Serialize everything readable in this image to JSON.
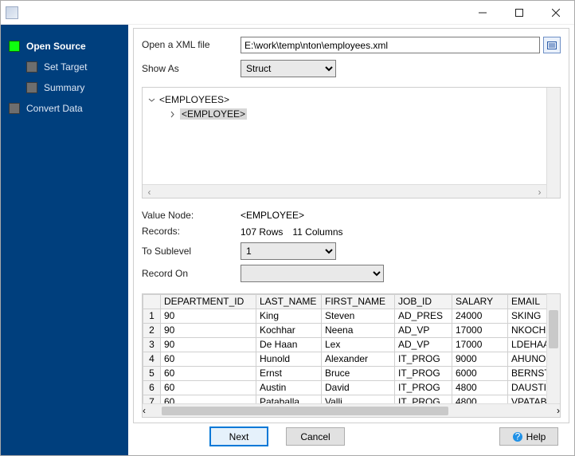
{
  "titlebar": {},
  "sidebar": {
    "items": [
      {
        "label": "Open Source",
        "active": true,
        "child": false
      },
      {
        "label": "Set Target",
        "active": false,
        "child": true
      },
      {
        "label": "Summary",
        "active": false,
        "child": true
      },
      {
        "label": "Convert Data",
        "active": false,
        "child": false
      }
    ]
  },
  "form": {
    "open_label": "Open a XML file",
    "file_path": "E:\\work\\temp\\nton\\employees.xml",
    "showas_label": "Show As",
    "showas_value": "Struct",
    "tree": {
      "root": "<EMPLOYEES>",
      "child": "<EMPLOYEE>"
    },
    "value_node_label": "Value Node:",
    "value_node": "<EMPLOYEE>",
    "records_label": "Records:",
    "records_rows": "107 Rows",
    "records_cols": "11 Columns",
    "tosub_label": "To Sublevel",
    "tosub_value": "1",
    "recordon_label": "Record On",
    "recordon_value": ""
  },
  "grid": {
    "columns": [
      "DEPARTMENT_ID",
      "LAST_NAME",
      "FIRST_NAME",
      "JOB_ID",
      "SALARY",
      "EMAIL"
    ],
    "rows": [
      {
        "n": "1",
        "dept": "90",
        "last": "King",
        "first": "Steven",
        "job": "AD_PRES",
        "sal": "24000",
        "email": "SKING"
      },
      {
        "n": "2",
        "dept": "90",
        "last": "Kochhar",
        "first": "Neena",
        "job": "AD_VP",
        "sal": "17000",
        "email": "NKOCHH"
      },
      {
        "n": "3",
        "dept": "90",
        "last": "De Haan",
        "first": "Lex",
        "job": "AD_VP",
        "sal": "17000",
        "email": "LDEHAAN"
      },
      {
        "n": "4",
        "dept": "60",
        "last": "Hunold",
        "first": "Alexander",
        "job": "IT_PROG",
        "sal": "9000",
        "email": "AHUNOL"
      },
      {
        "n": "5",
        "dept": "60",
        "last": "Ernst",
        "first": "Bruce",
        "job": "IT_PROG",
        "sal": "6000",
        "email": "BERNST"
      },
      {
        "n": "6",
        "dept": "60",
        "last": "Austin",
        "first": "David",
        "job": "IT_PROG",
        "sal": "4800",
        "email": "DAUSTIN"
      },
      {
        "n": "7",
        "dept": "60",
        "last": "Pataballa",
        "first": "Valli",
        "job": "IT_PROG",
        "sal": "4800",
        "email": "VPATABA"
      }
    ]
  },
  "buttons": {
    "next": "Next",
    "cancel": "Cancel",
    "help": "Help"
  }
}
